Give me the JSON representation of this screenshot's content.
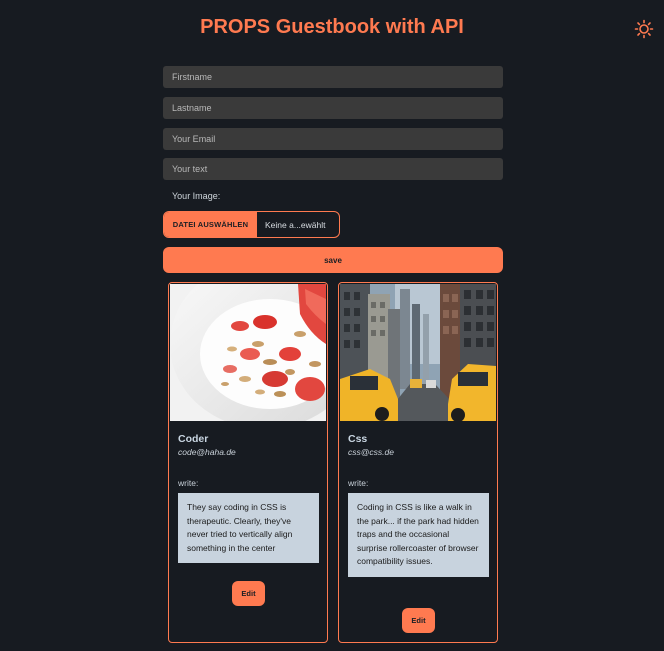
{
  "header": {
    "title": "PROPS Guestbook with API"
  },
  "form": {
    "firstname_placeholder": "Firstname",
    "lastname_placeholder": "Lastname",
    "email_placeholder": "Your Email",
    "text_placeholder": "Your text",
    "image_label": "Your Image:",
    "file_button_label": "DATEI AUSWÄHLEN",
    "file_name": "Keine a...ewählt",
    "save_label": "save"
  },
  "entries": [
    {
      "name": "Coder",
      "email": "code@haha.de",
      "write_label": "write:",
      "text": "They say coding in CSS is therapeutic. Clearly, they've never tried to vertically align something in the center",
      "edit_label": "Edit",
      "image_icon": "yogurt-strawberry-photo"
    },
    {
      "name": "Css",
      "email": "css@css.de",
      "write_label": "write:",
      "text": "Coding in CSS is like a walk in the park... if the park had hidden traps and the occasional surprise rollercoaster of browser compatibility issues.",
      "edit_label": "Edit",
      "image_icon": "city-street-taxis-photo"
    }
  ],
  "colors": {
    "accent": "#ff7a50",
    "background": "#171b21",
    "input_bg": "#3a3a3a",
    "text_box_bg": "#c8d3de"
  }
}
